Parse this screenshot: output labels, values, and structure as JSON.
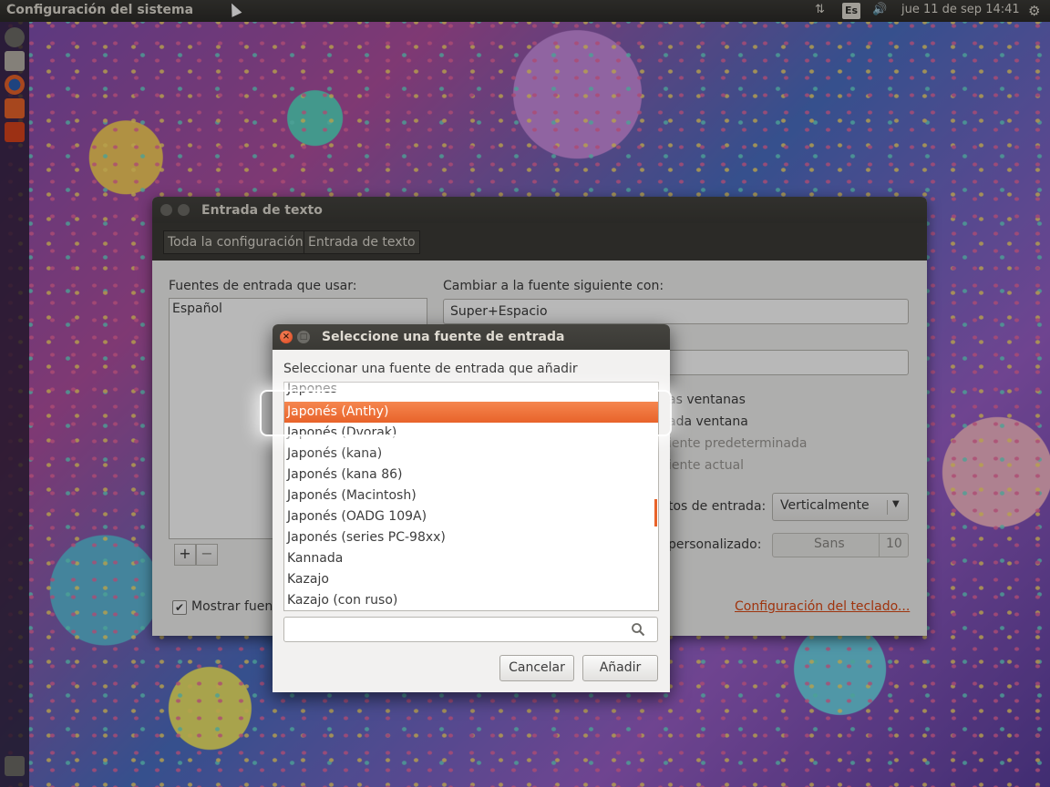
{
  "topbar": {
    "app_title": "Configuración del sistema",
    "keyboard_indicator": "Es",
    "datetime": "jue 11 de sep 14:41",
    "icons": [
      "network-updown-icon",
      "keyboard-layout-icon",
      "volume-icon",
      "gear-icon"
    ]
  },
  "launcher": {
    "items": [
      "dash-icon",
      "files-icon",
      "firefox-icon",
      "software-center-icon",
      "system-settings-icon",
      "trash-icon"
    ]
  },
  "main_window": {
    "title": "Entrada de texto",
    "breadcrumbs": [
      "Toda la configuración",
      "Entrada de texto"
    ],
    "sources_label": "Fuentes de entrada que usar:",
    "sources": [
      "Español"
    ],
    "add_label": "+",
    "remove_label": "−",
    "switch_next_label": "Cambiar a la fuente siguiente con:",
    "switch_next_value": "Super+Espacio",
    "switch_prev_value": "",
    "option_same_all": "as ventanas",
    "option_each_window": "ada ventana",
    "option_default_source": "iente predeterminada",
    "option_current_source": "iente actual",
    "show_sources_label": "tos de entrada:",
    "show_sources_value": "Verticalmente",
    "custom_font_label": "personalizado:",
    "custom_font_name": "Sans",
    "custom_font_size": "10",
    "show_current_checkbox": "Mostrar fuen",
    "keyboard_settings_link": "Configuración del teclado..."
  },
  "dialog": {
    "title": "Seleccione una fuente de entrada",
    "prompt": "Seleccionar una fuente de entrada que añadir",
    "items": [
      "Japones",
      "Japonés (Anthy)",
      "Japonés (Dvorak)",
      "Japonés (kana)",
      "Japonés (kana 86)",
      "Japonés (Macintosh)",
      "Japonés (OADG 109A)",
      "Japonés (series PC-98xx)",
      "Kannada",
      "Kazajo",
      "Kazajo (con ruso)"
    ],
    "selected_index": 1,
    "search_value": "",
    "cancel_label": "Cancelar",
    "add_label": "Añadir"
  },
  "colors": {
    "accent": "#e8632a",
    "link": "#dd4814",
    "titlebar": "#3c3b37"
  }
}
